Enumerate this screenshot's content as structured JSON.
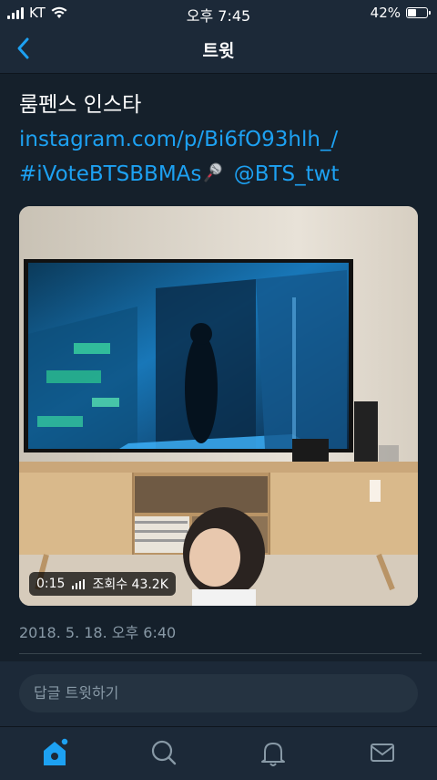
{
  "status_bar": {
    "carrier": "KT",
    "time": "오후 7:45",
    "battery_percent": "42%",
    "battery_level": 0.42
  },
  "nav": {
    "title": "트윗",
    "back_icon": "chevron-left-icon"
  },
  "tweet": {
    "text_line1": "룸펜스 인스타",
    "link": "instagram.com/p/Bi6fO93hlh_/",
    "hashtag": "#iVoteBTSBBMAs",
    "mention": "@BTS_twt",
    "timestamp": "2018. 5. 18. 오후 6:40"
  },
  "video": {
    "duration": "0:15",
    "views": "조회수 43.2K"
  },
  "reply": {
    "placeholder": "답글 트윗하기"
  },
  "tab_bar": {
    "items": [
      {
        "icon": "home-icon",
        "active": true
      },
      {
        "icon": "search-icon",
        "active": false
      },
      {
        "icon": "bell-icon",
        "active": false
      },
      {
        "icon": "mail-icon",
        "active": false
      }
    ]
  },
  "colors": {
    "background": "#15202b",
    "bar": "#1c2938",
    "accent": "#1da1f2",
    "secondary_text": "#8899a6"
  }
}
